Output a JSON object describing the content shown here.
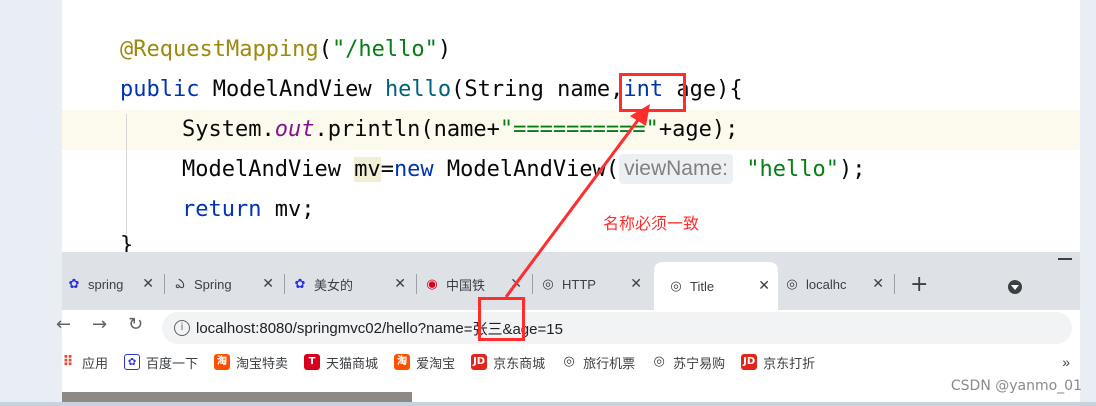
{
  "editor": {
    "line1": {
      "annotation": "@RequestMapping",
      "open": "(",
      "path": "\"/hello\"",
      "close": ")"
    },
    "line2": {
      "kw_public": "public",
      "type": "ModelAndView",
      "method": "hello",
      "params_open": "(String ",
      "param_name": "name",
      "comma": ",",
      "kw_int": "int",
      "rest": " age){"
    },
    "line3": {
      "obj": "System.",
      "out": "out",
      "call": ".println(name+",
      "str": "\"==========\"",
      "tail": "+age);"
    },
    "line4": {
      "type": "ModelAndView ",
      "var": "mv",
      "eq": "=",
      "kw_new": "new",
      "ctor": " ModelAndView(",
      "hint": "viewName:",
      "str": "\"hello\"",
      "tail": ");"
    },
    "line5": {
      "kw_return": "return",
      "tail": " mv;"
    },
    "line6": {
      "brace": "}"
    }
  },
  "annotation_text": "名称必须一致",
  "browser": {
    "tabs": [
      {
        "label": "spring",
        "icon": "baidu-paw-icon"
      },
      {
        "label": "Spring",
        "icon": "spring-icon"
      },
      {
        "label": "美女的",
        "icon": "baidu-paw-icon"
      },
      {
        "label": "中国铁",
        "icon": "railway-icon"
      },
      {
        "label": "HTTP",
        "icon": "globe-icon"
      },
      {
        "label": "Title",
        "icon": "globe-icon"
      },
      {
        "label": "localhc",
        "icon": "globe-icon"
      }
    ],
    "close_glyph": "✕",
    "new_tab": "+",
    "url_prefix": "localhost:8080/springmvc02/hello?",
    "url_param": "name",
    "url_suffix": "=张三&age=15",
    "bookmarks": [
      {
        "label": "应用",
        "icon": "apps-grid-icon",
        "color": "#e8453c"
      },
      {
        "label": "百度一下",
        "icon": "baidu-paw-icon",
        "color": "#2932e1"
      },
      {
        "label": "淘宝特卖",
        "icon": "taobao-icon",
        "color": "#ff5000"
      },
      {
        "label": "天猫商城",
        "icon": "tmall-icon",
        "color": "#d6001c"
      },
      {
        "label": "爱淘宝",
        "icon": "taobao-icon",
        "color": "#ff5000"
      },
      {
        "label": "京东商城",
        "icon": "jd-icon",
        "color": "#e1251b"
      },
      {
        "label": "旅行机票",
        "icon": "globe-icon",
        "color": "#3c4043"
      },
      {
        "label": "苏宁易购",
        "icon": "globe-icon",
        "color": "#3c4043"
      },
      {
        "label": "京东打折",
        "icon": "jd-icon",
        "color": "#e1251b"
      }
    ],
    "bookmarks_more": "»"
  },
  "watermark": "CSDN @yanmo_01",
  "colors": {
    "annotation_red": "#ff2d2d",
    "keyword": "#0033b3",
    "string": "#067d17"
  }
}
